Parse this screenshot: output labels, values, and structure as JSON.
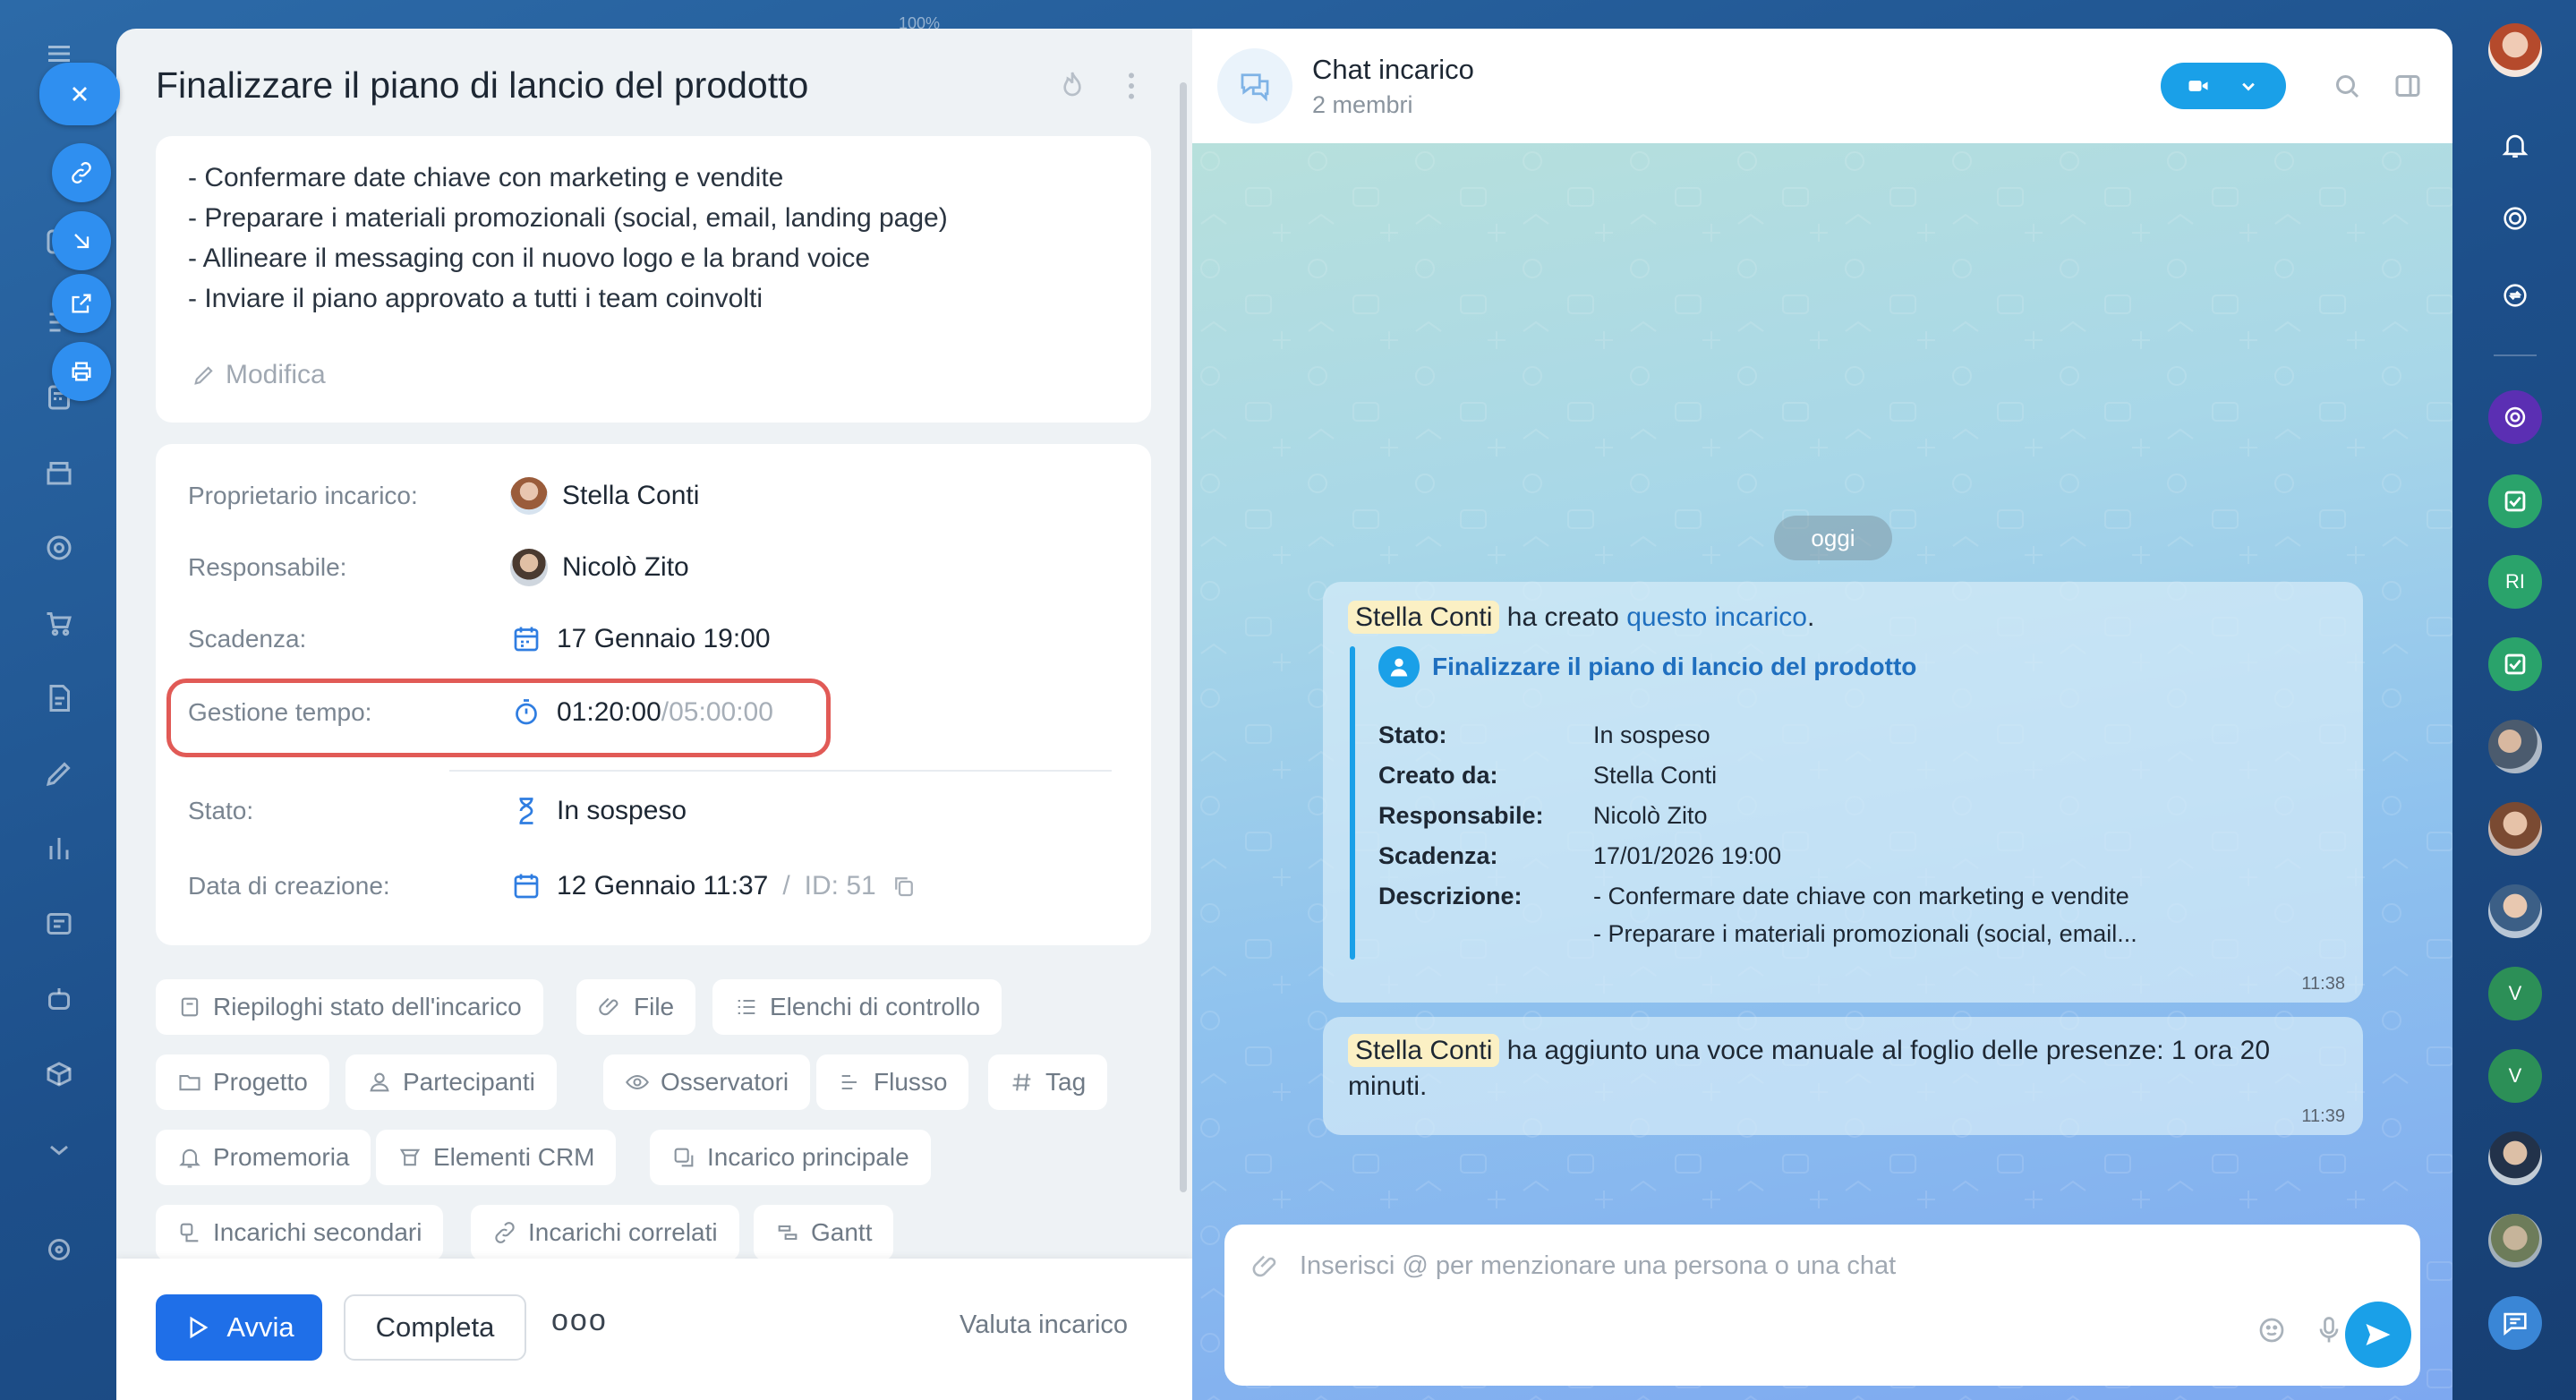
{
  "zoom_label": "100%",
  "task": {
    "title": "Finalizzare il piano di lancio del prodotto",
    "description": [
      "- Confermare date chiave con marketing e vendite",
      "- Preparare i materiali promozionali (social, email, landing page)",
      "- Allineare il messaging con il nuovo logo e la brand voice",
      "- Inviare il piano approvato a tutti i team coinvolti"
    ],
    "edit_label": "Modifica",
    "fields": {
      "owner_label": "Proprietario incarico:",
      "owner_value": "Stella Conti",
      "responsible_label": "Responsabile:",
      "responsible_value": "Nicolò Zito",
      "deadline_label": "Scadenza:",
      "deadline_value": "17 Gennaio 19:00",
      "time_label": "Gestione tempo:",
      "time_spent": "01:20:00",
      "time_sep": "/",
      "time_estimate": "05:00:00",
      "status_label": "Stato:",
      "status_value": "In sospeso",
      "created_label": "Data di creazione:",
      "created_value": "12 Gennaio 11:37",
      "id_sep": "/",
      "id_value": "ID: 51"
    },
    "chips": [
      "Riepiloghi stato dell'incarico",
      "File",
      "Elenchi di controllo",
      "Progetto",
      "Partecipanti",
      "Osservatori",
      "Flusso",
      "Tag",
      "Promemoria",
      "Elementi CRM",
      "Incarico principale",
      "Incarichi secondari",
      "Incarichi correlati",
      "Gantt"
    ],
    "footer": {
      "start_label": "Avvia",
      "complete_label": "Completa",
      "more_label": "ooo",
      "rate_label": "Valuta incarico"
    }
  },
  "chat": {
    "title": "Chat incarico",
    "members": "2 membri",
    "date_pill": "oggi",
    "msg1": {
      "author": "Stella Conti",
      "text": "ha creato",
      "link": "questo incarico",
      "tail": ".",
      "quote_title": "Finalizzare il piano di lancio del prodotto",
      "rows": [
        {
          "k": "Stato:",
          "v": "In sospeso"
        },
        {
          "k": "Creato da:",
          "v": "Stella Conti"
        },
        {
          "k": "Responsabile:",
          "v": "Nicolò Zito"
        },
        {
          "k": "Scadenza:",
          "v": "17/01/2026 19:00"
        },
        {
          "k": "Descrizione:",
          "v": "- Confermare date chiave con marketing e vendite"
        },
        {
          "k": "",
          "v": "- Preparare i materiali promozionali (social, email..."
        }
      ],
      "time": "11:38"
    },
    "msg2": {
      "author": "Stella Conti",
      "text_line1": "ha aggiunto una voce manuale al foglio delle presenze: 1 ora 20",
      "text_line2": "minuti.",
      "time": "11:39"
    },
    "input_placeholder": "Inserisci @ per menzionare una persona o una chat"
  },
  "rightbar": {
    "badge_ri": "RI",
    "badge_v1": "V",
    "badge_v2": "V"
  },
  "colors": {
    "accent": "#1f6fe8",
    "highlight": "#e15a56",
    "chat_accent": "#1aa0e8"
  }
}
